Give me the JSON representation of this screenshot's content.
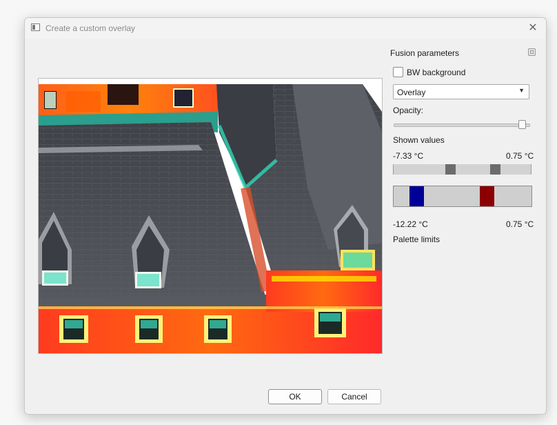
{
  "window": {
    "title": "Create a custom overlay",
    "close_glyph": "✕"
  },
  "fusion": {
    "title": "Fusion parameters",
    "bw_background_label": "BW background",
    "bw_background_checked": false,
    "mode_value": "Overlay",
    "mode_arrow": "▼",
    "opacity_label": "Opacity:",
    "opacity_value_fraction": 0.98
  },
  "shown_values": {
    "label": "Shown values",
    "min": "-7.33 °C",
    "max": "0.75 °C",
    "handle_low_fraction": 0.41,
    "handle_high_fraction": 0.76
  },
  "palette": {
    "min": "-12.22 °C",
    "max": "0.75 °C",
    "label": "Palette limits",
    "low_color": "#000099",
    "high_color": "#8b0000",
    "handle_low_fraction": 0.13,
    "handle_high_fraction": 0.7
  },
  "buttons": {
    "ok": "OK",
    "cancel": "Cancel"
  },
  "colors": {
    "hot": "#ff3b1f",
    "warm": "#ffb200",
    "cool": "#2fd6b6",
    "roof": "#46494f"
  }
}
